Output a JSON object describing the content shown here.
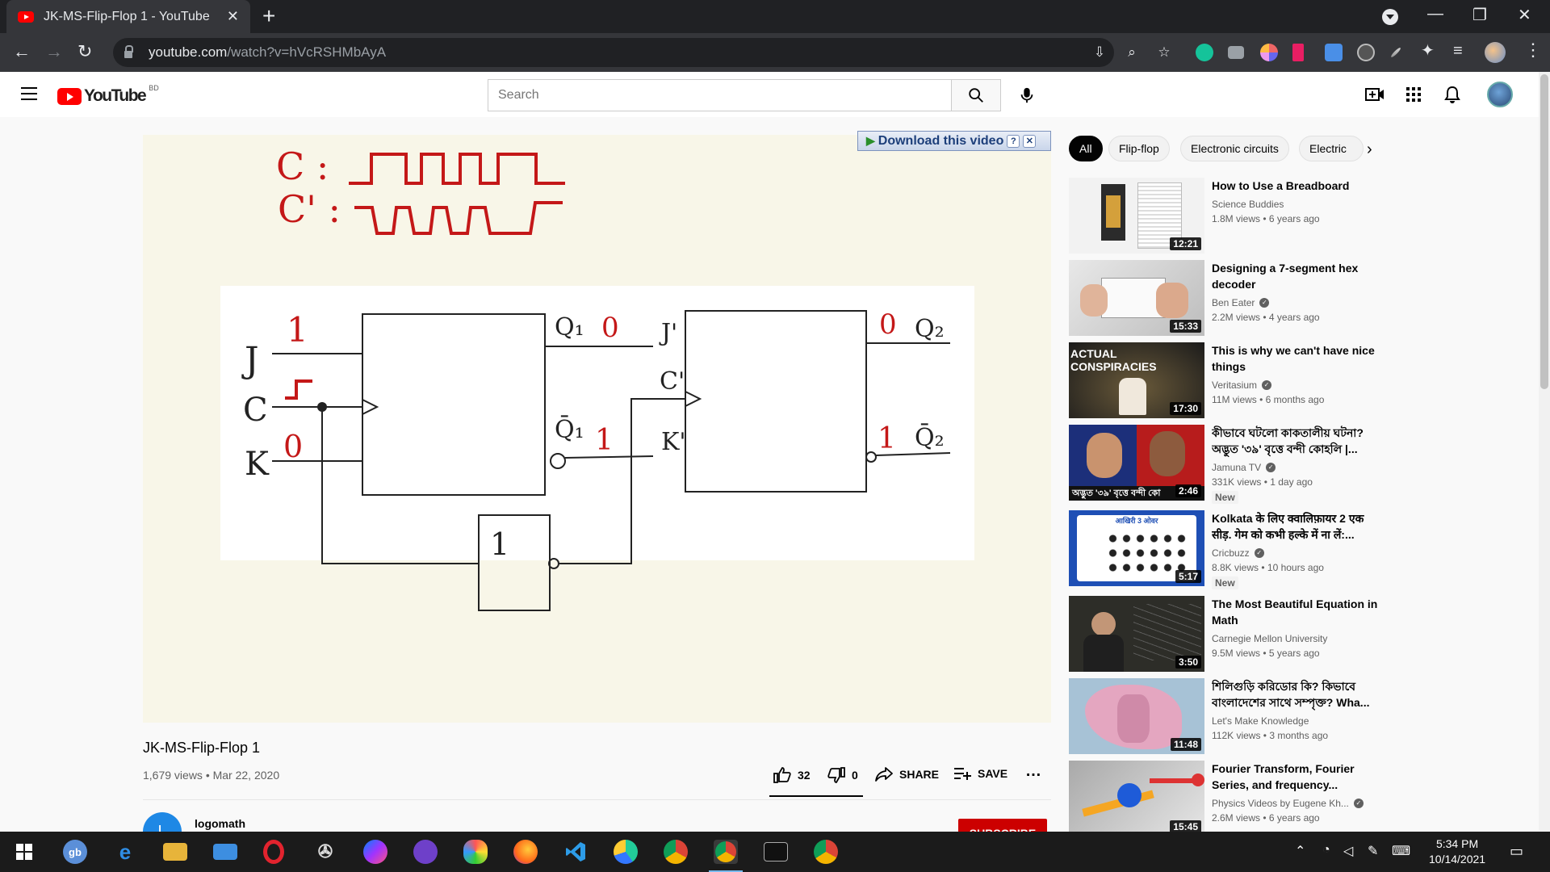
{
  "browser": {
    "tab_title": "JK-MS-Flip-Flop 1 - YouTube",
    "tab_close": "✕",
    "new_tab": "+",
    "url_host": "youtube.com",
    "url_path": "/watch?v=hVcRSHMbAyA",
    "win_minimize": "—",
    "win_restore": "❐",
    "win_close": "✕"
  },
  "header": {
    "logo_text": "YouTube",
    "country_code": "BD",
    "search_placeholder": "Search"
  },
  "video": {
    "download_label": "Download this video",
    "title": "JK-MS-Flip-Flop 1",
    "meta": "1,679 views • Mar 22, 2020",
    "likes": "32",
    "dislikes": "0",
    "share_label": "SHARE",
    "save_label": "SAVE",
    "more_label": "…",
    "like_ratio": 1.0
  },
  "whiteboard": {
    "clock_c": "C :",
    "clock_c_prime": "C' :",
    "input_j": "J",
    "input_c": "C",
    "input_k": "K",
    "val_j": "1",
    "val_c_pulse": "⎍",
    "val_k": "0",
    "out_q1": "Q₁",
    "out_q1_val": "0",
    "out_q1bar": "Q̄₁",
    "out_q1bar_val": "1",
    "in_j_prime": "J'",
    "in_c_prime": "C'",
    "in_k_prime": "K'",
    "out_q2": "Q₂",
    "out_q2_val": "0",
    "out_q2bar": "Q̄₂",
    "out_q2bar_val": "1",
    "not_gate_label": "1"
  },
  "channel": {
    "avatar_letter": "L",
    "name": "logomath",
    "subscribe_label": "SUBSCRIBE"
  },
  "chips": [
    "All",
    "Flip-flop",
    "Electronic circuits",
    "Electric"
  ],
  "chips_next": "›",
  "recommendations": [
    {
      "title": "How to Use a Breadboard",
      "channel": "Science Buddies",
      "verified": false,
      "meta": "1.8M views • 6 years ago",
      "duration": "12:21",
      "is_new": false
    },
    {
      "title": "Designing a 7-segment hex decoder",
      "channel": "Ben Eater",
      "verified": true,
      "meta": "2.2M views • 4 years ago",
      "duration": "15:33",
      "is_new": false
    },
    {
      "title": "This is why we can't have nice things",
      "channel": "Veritasium",
      "verified": true,
      "meta": "11M views • 6 months ago",
      "duration": "17:30",
      "is_new": false,
      "thumb_text": "ACTUAL CONSPIRACIES"
    },
    {
      "title": "কীভাবে ঘটলো কাকতালীয় ঘটনা? অদ্ভুত '৩৯' বৃত্তে বন্দী কোহলি |...",
      "channel": "Jamuna TV",
      "verified": true,
      "meta": "331K views • 1 day ago",
      "duration": "2:46",
      "is_new": true,
      "thumb_text": "অদ্ভুত '৩৯' বৃত্তে বন্দী কো"
    },
    {
      "title": "Kolkata के लिए क्वालिफ़ायर 2 एक सीड़. गेम को कभी हल्के में ना लें:...",
      "channel": "Cricbuzz",
      "verified": true,
      "meta": "8.8K views • 10 hours ago",
      "duration": "5:17",
      "is_new": true,
      "thumb_text": "आखिरी 3 ओवर"
    },
    {
      "title": "The Most Beautiful Equation in Math",
      "channel": "Carnegie Mellon University",
      "verified": false,
      "meta": "9.5M views • 5 years ago",
      "duration": "3:50",
      "is_new": false
    },
    {
      "title": "শিলিগুড়ি করিডোর কি? কিভাবে বাংলাদেশের সাথে সম্পৃক্ত? Wha...",
      "channel": "Let's Make Knowledge",
      "verified": false,
      "meta": "112K views • 3 months ago",
      "duration": "11:48",
      "is_new": false
    },
    {
      "title": "Fourier Transform, Fourier Series, and frequency...",
      "channel": "Physics Videos by Eugene Kh...",
      "verified": true,
      "meta": "2.6M views • 6 years ago",
      "duration": "15:45",
      "is_new": false
    }
  ],
  "new_badge": "New",
  "taskbar": {
    "time": "5:34 PM",
    "date": "10/14/2021",
    "apps": [
      "start-button",
      "gb-app",
      "edge",
      "file-explorer",
      "mail",
      "opera",
      "app-satellite",
      "messenger",
      "github-desktop",
      "paint-app",
      "firefox",
      "vscode",
      "app-globe",
      "chrome-1",
      "chrome-2",
      "terminal",
      "chrome-3"
    ]
  },
  "colors": {
    "brand_red": "#ff0000",
    "ink_red": "#c41818",
    "ink_black": "#222222",
    "board_bg": "#f8f6e8"
  }
}
